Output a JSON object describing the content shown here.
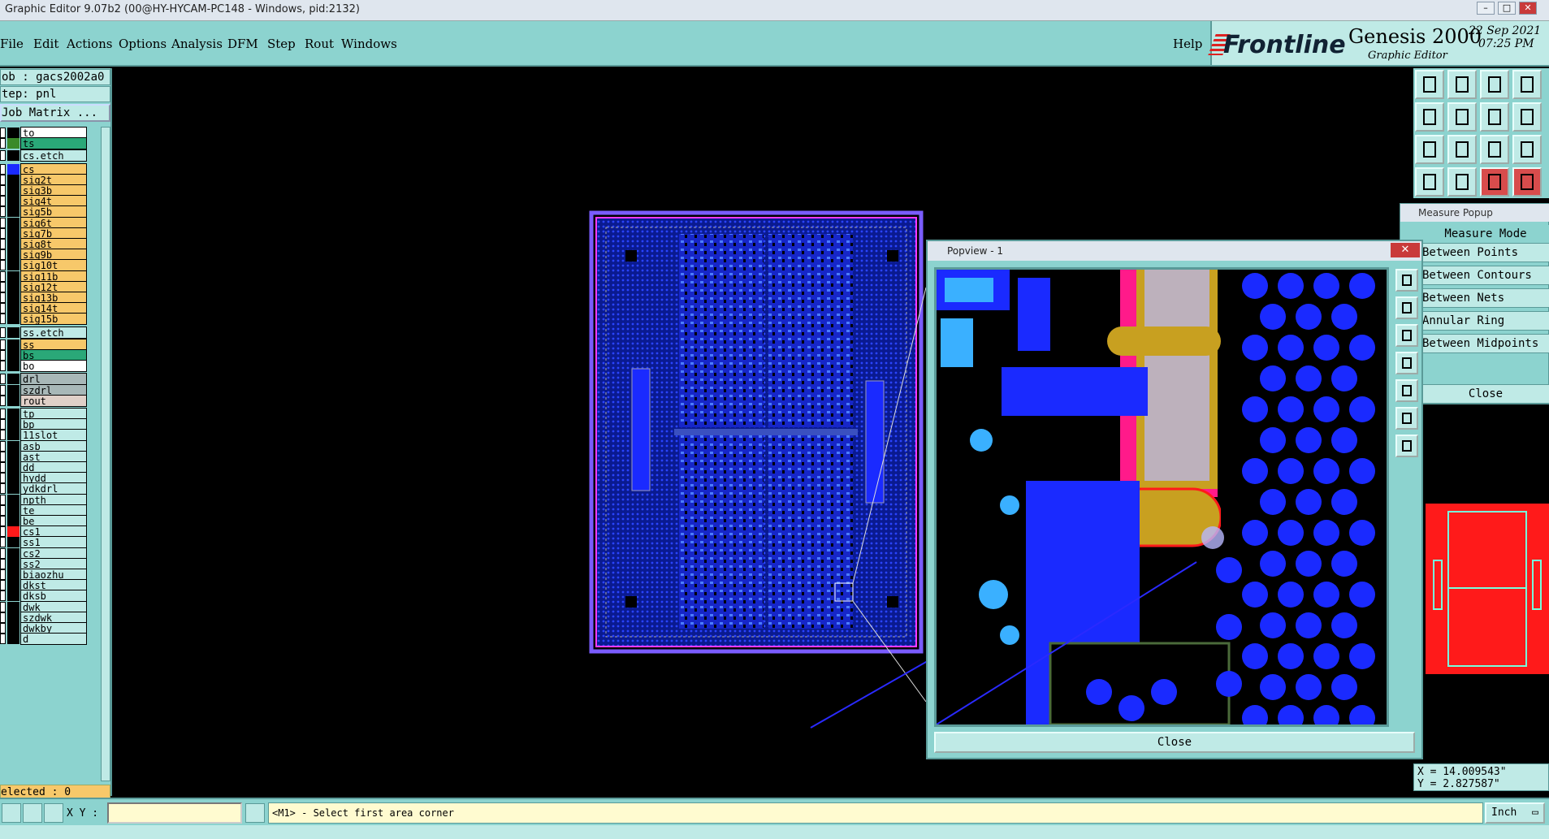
{
  "window": {
    "title": "Graphic Editor 9.07b2 (00@HY-HYCAM-PC148 - Windows, pid:2132)"
  },
  "menu": {
    "items": [
      "File",
      "Edit",
      "Actions",
      "Options",
      "Analysis",
      "DFM",
      "Step",
      "Rout",
      "Windows"
    ],
    "help": "Help"
  },
  "brand": {
    "logo": "Frontline",
    "product": "Genesis 2000",
    "subtitle": "Graphic Editor",
    "date": "22 Sep 2021",
    "time": "07:25 PM"
  },
  "job": {
    "job_line": "ob : gacs2002a0",
    "step_line": "tep: pnl",
    "matrix_button": "Job Matrix ..."
  },
  "layers": [
    {
      "name": "to",
      "swatch": "#000000",
      "bg": "#ffffff"
    },
    {
      "name": "ts",
      "swatch": "#3a8a2a",
      "bg": "#2aa878"
    },
    {
      "name": "cs.etch",
      "swatch": "#000000",
      "bg": "#bfeae6"
    },
    {
      "name": "cs",
      "swatch": "#1a2aff",
      "bg": "#f7c86a"
    },
    {
      "name": "sig2t",
      "swatch": "#000000",
      "bg": "#f7c86a"
    },
    {
      "name": "sig3b",
      "swatch": "#000000",
      "bg": "#f7c86a"
    },
    {
      "name": "sig4t",
      "swatch": "#000000",
      "bg": "#f7c86a"
    },
    {
      "name": "sig5b",
      "swatch": "#000000",
      "bg": "#f7c86a"
    },
    {
      "name": "sig6t",
      "swatch": "#000000",
      "bg": "#f7c86a"
    },
    {
      "name": "sig7b",
      "swatch": "#000000",
      "bg": "#f7c86a"
    },
    {
      "name": "sig8t",
      "swatch": "#000000",
      "bg": "#f7c86a"
    },
    {
      "name": "sig9b",
      "swatch": "#000000",
      "bg": "#f7c86a"
    },
    {
      "name": "sig10t",
      "swatch": "#000000",
      "bg": "#f7c86a"
    },
    {
      "name": "sig11b",
      "swatch": "#000000",
      "bg": "#f7c86a"
    },
    {
      "name": "sig12t",
      "swatch": "#000000",
      "bg": "#f7c86a"
    },
    {
      "name": "sig13b",
      "swatch": "#000000",
      "bg": "#f7c86a"
    },
    {
      "name": "sig14t",
      "swatch": "#000000",
      "bg": "#f7c86a"
    },
    {
      "name": "sig15b",
      "swatch": "#000000",
      "bg": "#f7c86a"
    },
    {
      "name": "ss.etch",
      "swatch": "#000000",
      "bg": "#bfeae6"
    },
    {
      "name": "ss",
      "swatch": "#000000",
      "bg": "#f7c86a"
    },
    {
      "name": "bs",
      "swatch": "#000000",
      "bg": "#2aa878"
    },
    {
      "name": "bo",
      "swatch": "#000000",
      "bg": "#ffffff"
    },
    {
      "name": "drl",
      "swatch": "#000000",
      "bg": "#a8b8b8"
    },
    {
      "name": "szdrl",
      "swatch": "#000000",
      "bg": "#a8b8b8"
    },
    {
      "name": "rout",
      "swatch": "#000000",
      "bg": "#e0d0c8"
    },
    {
      "name": "tp",
      "swatch": "#000000",
      "bg": "#bfeae6"
    },
    {
      "name": "bp",
      "swatch": "#000000",
      "bg": "#bfeae6"
    },
    {
      "name": "11slot",
      "swatch": "#000000",
      "bg": "#bfeae6"
    },
    {
      "name": "asb",
      "swatch": "#000000",
      "bg": "#bfeae6"
    },
    {
      "name": "ast",
      "swatch": "#000000",
      "bg": "#bfeae6"
    },
    {
      "name": "dd",
      "swatch": "#000000",
      "bg": "#bfeae6"
    },
    {
      "name": "hydd",
      "swatch": "#000000",
      "bg": "#bfeae6"
    },
    {
      "name": "ydkdrl",
      "swatch": "#000000",
      "bg": "#bfeae6"
    },
    {
      "name": "npth",
      "swatch": "#000000",
      "bg": "#bfeae6"
    },
    {
      "name": "te",
      "swatch": "#000000",
      "bg": "#bfeae6"
    },
    {
      "name": "be",
      "swatch": "#000000",
      "bg": "#bfeae6"
    },
    {
      "name": "cs1",
      "swatch": "#ff1a1a",
      "bg": "#bfeae6"
    },
    {
      "name": "ss1",
      "swatch": "#000000",
      "bg": "#bfeae6"
    },
    {
      "name": "cs2",
      "swatch": "#000000",
      "bg": "#bfeae6"
    },
    {
      "name": "ss2",
      "swatch": "#000000",
      "bg": "#bfeae6"
    },
    {
      "name": "biaozhu",
      "swatch": "#000000",
      "bg": "#bfeae6"
    },
    {
      "name": "dkst",
      "swatch": "#000000",
      "bg": "#bfeae6"
    },
    {
      "name": "dksb",
      "swatch": "#000000",
      "bg": "#bfeae6"
    },
    {
      "name": "dwk",
      "swatch": "#000000",
      "bg": "#bfeae6"
    },
    {
      "name": "szdwk",
      "swatch": "#000000",
      "bg": "#bfeae6"
    },
    {
      "name": "dwkby",
      "swatch": "#000000",
      "bg": "#bfeae6"
    },
    {
      "name": "d",
      "swatch": "#000000",
      "bg": "#bfeae6"
    }
  ],
  "selected": "elected : 0",
  "measure": {
    "title": "Measure Popup",
    "mode_label": "Measure Mode",
    "modes": [
      "Between Points",
      "Between Contours",
      "Between Nets",
      "Annular Ring",
      "Between Midpoints"
    ],
    "close": "Close"
  },
  "popview": {
    "title": "Popview - 1",
    "close": "Close"
  },
  "coords": {
    "x_line": "X = 14.009543\"",
    "y_line": "Y = 2.827587\""
  },
  "status": {
    "xy_label": "X Y :",
    "xy_value": "",
    "prompt": "<M1> - Select first area corner",
    "units": "Inch"
  },
  "colors": {
    "panel": "#8cd3cf",
    "panel_light": "#bfeae6",
    "active_layer": "#f7c86a",
    "pcb_blue": "#1a2aff",
    "copper": "#c8a020"
  }
}
